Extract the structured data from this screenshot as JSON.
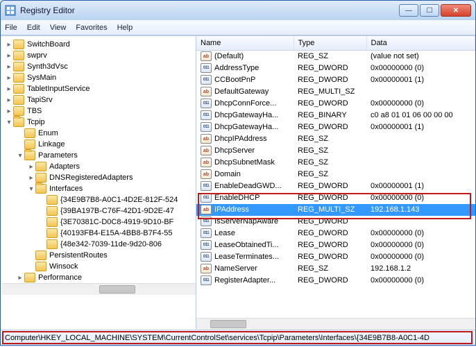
{
  "window": {
    "title": "Registry Editor"
  },
  "menu": {
    "file": "File",
    "edit": "Edit",
    "view": "View",
    "favorites": "Favorites",
    "help": "Help"
  },
  "tree": [
    {
      "depth": 0,
      "exp": "r",
      "label": "SwitchBoard"
    },
    {
      "depth": 0,
      "exp": "r",
      "label": "swprv"
    },
    {
      "depth": 0,
      "exp": "r",
      "label": "Synth3dVsc"
    },
    {
      "depth": 0,
      "exp": "r",
      "label": "SysMain"
    },
    {
      "depth": 0,
      "exp": "r",
      "label": "TabletInputService"
    },
    {
      "depth": 0,
      "exp": "r",
      "label": "TapiSrv"
    },
    {
      "depth": 0,
      "exp": "r",
      "label": "TBS"
    },
    {
      "depth": 0,
      "exp": "o",
      "label": "Tcpip"
    },
    {
      "depth": 1,
      "exp": "",
      "label": "Enum"
    },
    {
      "depth": 1,
      "exp": "",
      "label": "Linkage"
    },
    {
      "depth": 1,
      "exp": "o",
      "label": "Parameters"
    },
    {
      "depth": 2,
      "exp": "r",
      "label": "Adapters"
    },
    {
      "depth": 2,
      "exp": "r",
      "label": "DNSRegisteredAdapters"
    },
    {
      "depth": 2,
      "exp": "o",
      "label": "Interfaces"
    },
    {
      "depth": 3,
      "exp": "",
      "label": "{34E9B7B8-A0C1-4D2E-812F-524"
    },
    {
      "depth": 3,
      "exp": "",
      "label": "{39BA197B-C76F-42D1-9D2E-47"
    },
    {
      "depth": 3,
      "exp": "",
      "label": "{3E70381C-D0C8-4919-9D10-BF"
    },
    {
      "depth": 3,
      "exp": "",
      "label": "{40193FB4-E15A-4BB8-B7F4-55"
    },
    {
      "depth": 3,
      "exp": "",
      "label": "{48e342-7039-11de-9d20-806"
    },
    {
      "depth": 2,
      "exp": "",
      "label": "PersistentRoutes"
    },
    {
      "depth": 2,
      "exp": "",
      "label": "Winsock"
    },
    {
      "depth": 1,
      "exp": "r",
      "label": "Performance"
    }
  ],
  "list": {
    "headers": {
      "name": "Name",
      "type": "Type",
      "data": "Data"
    },
    "rows": [
      {
        "icon": "sz",
        "name": "(Default)",
        "type": "REG_SZ",
        "data": "(value not set)"
      },
      {
        "icon": "bin",
        "name": "AddressType",
        "type": "REG_DWORD",
        "data": "0x00000000 (0)"
      },
      {
        "icon": "bin",
        "name": "CCBootPnP",
        "type": "REG_DWORD",
        "data": "0x00000001 (1)"
      },
      {
        "icon": "sz",
        "name": "DefaultGateway",
        "type": "REG_MULTI_SZ",
        "data": ""
      },
      {
        "icon": "bin",
        "name": "DhcpConnForce...",
        "type": "REG_DWORD",
        "data": "0x00000000 (0)"
      },
      {
        "icon": "bin",
        "name": "DhcpGatewayHa...",
        "type": "REG_BINARY",
        "data": "c0 a8 01 01 06 00 00 00"
      },
      {
        "icon": "bin",
        "name": "DhcpGatewayHa...",
        "type": "REG_DWORD",
        "data": "0x00000001 (1)"
      },
      {
        "icon": "sz",
        "name": "DhcpIPAddress",
        "type": "REG_SZ",
        "data": ""
      },
      {
        "icon": "sz",
        "name": "DhcpServer",
        "type": "REG_SZ",
        "data": ""
      },
      {
        "icon": "sz",
        "name": "DhcpSubnetMask",
        "type": "REG_SZ",
        "data": ""
      },
      {
        "icon": "sz",
        "name": "Domain",
        "type": "REG_SZ",
        "data": ""
      },
      {
        "icon": "bin",
        "name": "EnableDeadGWD...",
        "type": "REG_DWORD",
        "data": "0x00000001 (1)"
      },
      {
        "icon": "bin",
        "name": "EnableDHCP",
        "type": "REG_DWORD",
        "data": "0x00000000 (0)"
      },
      {
        "icon": "sz",
        "name": "IPAddress",
        "type": "REG_MULTI_SZ",
        "data": "192.168.1.143",
        "selected": true
      },
      {
        "icon": "bin",
        "name": "IsServerNapAware",
        "type": "REG_DWORD",
        "data": ""
      },
      {
        "icon": "bin",
        "name": "Lease",
        "type": "REG_DWORD",
        "data": "0x00000000 (0)"
      },
      {
        "icon": "bin",
        "name": "LeaseObtainedTi...",
        "type": "REG_DWORD",
        "data": "0x00000000 (0)"
      },
      {
        "icon": "bin",
        "name": "LeaseTerminates...",
        "type": "REG_DWORD",
        "data": "0x00000000 (0)"
      },
      {
        "icon": "sz",
        "name": "NameServer",
        "type": "REG_SZ",
        "data": "192.168.1.2"
      },
      {
        "icon": "bin",
        "name": "RegisterAdapter...",
        "type": "REG_DWORD",
        "data": "0x00000000 (0)"
      }
    ]
  },
  "statusbar": "Computer\\HKEY_LOCAL_MACHINE\\SYSTEM\\CurrentControlSet\\services\\Tcpip\\Parameters\\Interfaces\\{34E9B7B8-A0C1-4D"
}
